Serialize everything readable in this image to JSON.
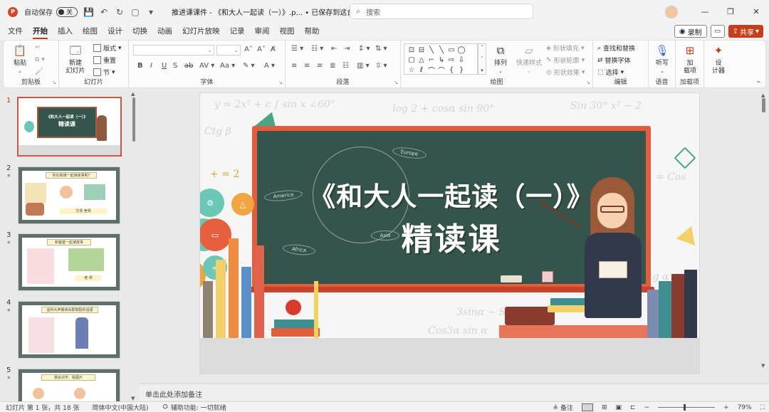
{
  "app": {
    "autosave_label": "自动保存",
    "autosave_state": "关",
    "doc_title": "推进课课件 - 《和大人一起读（一）》.p...  • 已保存到这台电脑",
    "search_placeholder": "搜索",
    "accent": "#c43e1c"
  },
  "tabs": [
    "文件",
    "开始",
    "插入",
    "绘图",
    "设计",
    "切换",
    "动画",
    "幻灯片放映",
    "记录",
    "审阅",
    "视图",
    "帮助"
  ],
  "active_tab": "开始",
  "topright": {
    "record": "录制",
    "share": "共享"
  },
  "ribbon": {
    "clipboard": {
      "paste": "粘贴",
      "label": "剪贴板"
    },
    "slides": {
      "new_slide": "新建\n幻灯片",
      "layout": "版式",
      "reset": "重置",
      "section": "节",
      "label": "幻灯片"
    },
    "font": {
      "label": "字体"
    },
    "paragraph": {
      "label": "段落"
    },
    "drawing": {
      "arrange": "排列",
      "quick_styles": "快速样式",
      "fill": "形状填充",
      "outline": "形状轮廓",
      "effects": "形状效果",
      "label": "绘图"
    },
    "editing": {
      "find_replace": "查找和替换",
      "replace_font": "替换字体",
      "select": "选择",
      "label": "编辑"
    },
    "voice": {
      "dictate": "听写",
      "label": "语音"
    },
    "addins": {
      "addins": "加\n载项",
      "label": "加载项"
    },
    "designer": {
      "designer": "设\n计器"
    }
  },
  "thumbnails": [
    {
      "num": "1",
      "title": "《和大人一起读（一）》",
      "subtitle": "精读课"
    },
    {
      "num": "2",
      "banner": "你在和谁一起读故事呢?",
      "caption": "文母   舍师"
    },
    {
      "num": "3",
      "banner": "和爸爸一起读故事",
      "caption": "老 师"
    },
    {
      "num": "4",
      "banner": "遥听大声朗读出那鼓励的话语"
    },
    {
      "num": "5",
      "banner": "我会识字、看图片"
    }
  ],
  "slide": {
    "title_line1": "《和大人一起读（一）》",
    "title_line2": "精读课",
    "chalk_words": [
      "Europe",
      "Asia",
      "America",
      "Africa"
    ]
  },
  "notes_placeholder": "单击此处添加备注",
  "status": {
    "slide_count": "幻灯片 第 1 张，共 18 张",
    "language": "简体中文(中国大陆)",
    "accessibility": "辅助功能: 一切就绪",
    "notes": "备注",
    "zoom": "79%"
  }
}
